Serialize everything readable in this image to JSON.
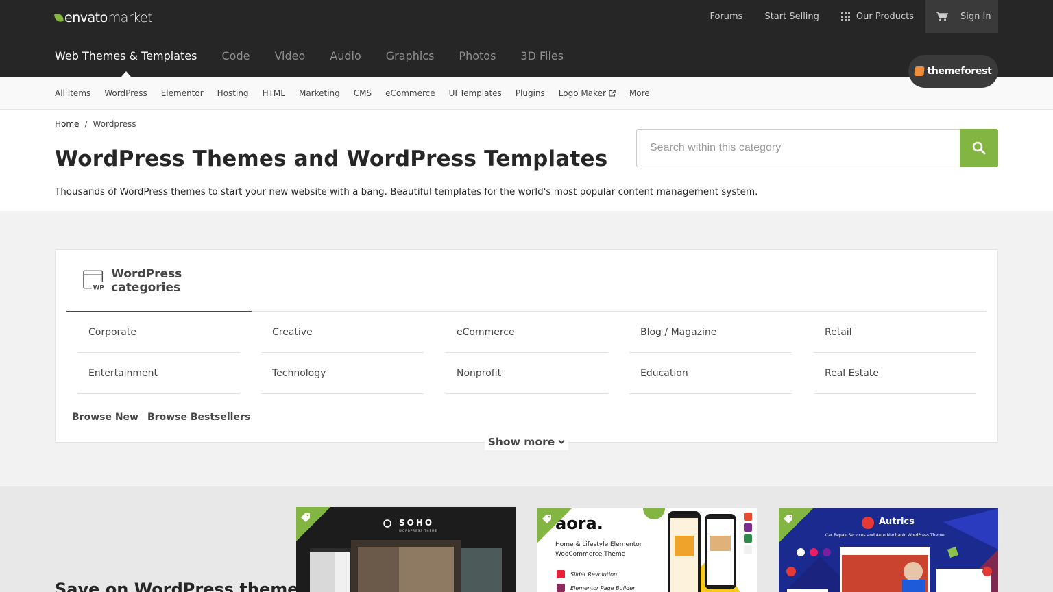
{
  "brand": {
    "logo_main": "envato",
    "logo_sub": "market",
    "accent": "#82b541"
  },
  "top_links": {
    "forums": "Forums",
    "start_selling": "Start Selling",
    "our_products": "Our Products",
    "sign_in": "Sign In"
  },
  "main_nav": [
    {
      "label": "Web Themes & Templates",
      "active": true
    },
    {
      "label": "Code"
    },
    {
      "label": "Video"
    },
    {
      "label": "Audio"
    },
    {
      "label": "Graphics"
    },
    {
      "label": "Photos"
    },
    {
      "label": "3D Files"
    }
  ],
  "site_badge": "themeforest",
  "sub_nav": [
    "All Items",
    "WordPress",
    "Elementor",
    "Hosting",
    "HTML",
    "Marketing",
    "CMS",
    "eCommerce",
    "UI Templates",
    "Plugins",
    "Logo Maker",
    "More"
  ],
  "breadcrumb": {
    "home": "Home",
    "separator": "/",
    "current": "Wordpress"
  },
  "page": {
    "title": "WordPress Themes and WordPress Templates",
    "description": "Thousands of WordPress themes to start your new website with a bang. Beautiful templates for the world's most popular content management system."
  },
  "search": {
    "placeholder": "Search within this category"
  },
  "categories": {
    "title": "WordPress categories",
    "items": [
      "Corporate",
      "Creative",
      "eCommerce",
      "Blog / Magazine",
      "Retail",
      "Entertainment",
      "Technology",
      "Nonprofit",
      "Education",
      "Real Estate"
    ],
    "browse_new": "Browse New",
    "browse_bestsellers": "Browse Bestsellers",
    "show_more": "Show more"
  },
  "promo": {
    "title": "Save on WordPress themes",
    "cards": [
      {
        "brand": "SOHO",
        "tagline": "WORDPRESS THEME"
      },
      {
        "brand": "aora.",
        "line1": "Home & Lifestyle Elementor",
        "line2": "WooCommerce Theme",
        "feature1": "Slider Revolution",
        "feature2": "Elementor Page Builder"
      },
      {
        "brand": "Autrics",
        "tagline": "Car Repair Services and Auto Mechanic WordPress Theme"
      }
    ]
  }
}
